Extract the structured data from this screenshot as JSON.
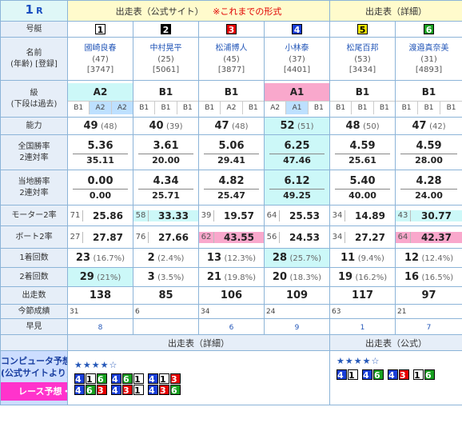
{
  "race": {
    "num": "1",
    "unit": "R"
  },
  "header": {
    "official": "出走表（公式サイト）",
    "former": "※これまでの形式",
    "detail": "出走表（詳細）"
  },
  "labels": {
    "frame": "号艇",
    "name": "名前",
    "name_sub": "(年齢) [登録]",
    "grade": "級",
    "grade_sub": "(下段は過去)",
    "ability": "能力",
    "nat": "全国勝率",
    "nat2": "2連対率",
    "loc": "当地勝率",
    "loc2": "2連対率",
    "motor": "モーター2率",
    "boat": "ボート2率",
    "first": "1着回数",
    "second": "2着回数",
    "starts": "出走数",
    "series": "今節成績",
    "tips": "早見"
  },
  "racers": [
    {
      "frame": "1",
      "name": "國崎良春",
      "age": "(47)",
      "reg": "[3747]",
      "grade": "A2",
      "past": [
        "B1",
        "A2",
        "A2"
      ],
      "ability": "49",
      "ability_prev": "(48)",
      "nat_win": "5.36",
      "nat_2": "35.11",
      "loc_win": "0.00",
      "loc_2": "0.00",
      "motor_no": "71",
      "motor_rate": "25.86",
      "boat_no": "27",
      "boat_rate": "27.87",
      "first": "23",
      "first_pct": "(16.7%)",
      "second": "29",
      "second_pct": "(21%)",
      "starts": "138",
      "series": "31",
      "tip": "8"
    },
    {
      "frame": "2",
      "name": "中村晃平",
      "age": "(25)",
      "reg": "[5061]",
      "grade": "B1",
      "past": [
        "B1",
        "B1",
        "B1"
      ],
      "ability": "40",
      "ability_prev": "(39)",
      "nat_win": "3.61",
      "nat_2": "20.00",
      "loc_win": "4.34",
      "loc_2": "25.71",
      "motor_no": "58",
      "motor_rate": "33.33",
      "boat_no": "76",
      "boat_rate": "27.66",
      "first": "2",
      "first_pct": "(2.4%)",
      "second": "3",
      "second_pct": "(3.5%)",
      "starts": "85",
      "series": "6",
      "tip": ""
    },
    {
      "frame": "3",
      "name": "松浦博人",
      "age": "(45)",
      "reg": "[3877]",
      "grade": "B1",
      "past": [
        "B1",
        "A2",
        "B1"
      ],
      "ability": "47",
      "ability_prev": "(48)",
      "nat_win": "5.06",
      "nat_2": "29.41",
      "loc_win": "4.82",
      "loc_2": "25.47",
      "motor_no": "39",
      "motor_rate": "19.57",
      "boat_no": "62",
      "boat_rate": "43.55",
      "first": "13",
      "first_pct": "(12.3%)",
      "second": "21",
      "second_pct": "(19.8%)",
      "starts": "106",
      "series": "34",
      "tip": "6"
    },
    {
      "frame": "4",
      "name": "小林泰",
      "age": "(37)",
      "reg": "[4401]",
      "grade": "A1",
      "past": [
        "A2",
        "A1",
        "B1"
      ],
      "ability": "52",
      "ability_prev": "(51)",
      "nat_win": "6.25",
      "nat_2": "47.46",
      "loc_win": "6.12",
      "loc_2": "49.25",
      "motor_no": "64",
      "motor_rate": "25.53",
      "boat_no": "56",
      "boat_rate": "24.53",
      "first": "28",
      "first_pct": "(25.7%)",
      "second": "20",
      "second_pct": "(18.3%)",
      "starts": "109",
      "series": "24",
      "tip": "9"
    },
    {
      "frame": "5",
      "name": "松尾百邦",
      "age": "(53)",
      "reg": "[3434]",
      "grade": "B1",
      "past": [
        "B1",
        "B1",
        "B1"
      ],
      "ability": "48",
      "ability_prev": "(50)",
      "nat_win": "4.59",
      "nat_2": "25.61",
      "loc_win": "5.40",
      "loc_2": "40.00",
      "motor_no": "34",
      "motor_rate": "14.89",
      "boat_no": "34",
      "boat_rate": "27.27",
      "first": "11",
      "first_pct": "(9.4%)",
      "second": "19",
      "second_pct": "(16.2%)",
      "starts": "117",
      "series": "63",
      "tip": "1"
    },
    {
      "frame": "6",
      "name": "渡邉真奈美",
      "age": "(31)",
      "reg": "[4893]",
      "grade": "B1",
      "past": [
        "B1",
        "B1",
        "B1"
      ],
      "ability": "47",
      "ability_prev": "(42)",
      "nat_win": "4.59",
      "nat_2": "28.00",
      "loc_win": "4.28",
      "loc_2": "24.00",
      "motor_no": "43",
      "motor_rate": "30.77",
      "boat_no": "64",
      "boat_rate": "42.37",
      "first": "12",
      "first_pct": "(12.4%)",
      "second": "16",
      "second_pct": "(16.5%)",
      "starts": "97",
      "series": "21",
      "tip": "7"
    }
  ],
  "footer": {
    "detail": "出走表（詳細）",
    "official": "出走表（公式）",
    "computer_title": "コンピュータ予想",
    "computer_sub": "(公式サイトより)",
    "result_btn": "レース予想・結果",
    "stars_left": "★★★★☆",
    "stars_right": "★★★★☆",
    "combos_left": [
      [
        "4",
        "1",
        "6"
      ],
      [
        "4",
        "6",
        "1"
      ],
      [
        "4",
        "1",
        "3"
      ],
      [
        "4",
        "6",
        "3"
      ],
      [
        "4",
        "3",
        "1"
      ],
      [
        "4",
        "3",
        "6"
      ]
    ],
    "combos_right": [
      [
        "4",
        "1"
      ],
      [
        "4",
        "6"
      ],
      [
        "4",
        "3"
      ],
      [
        "1",
        "6"
      ]
    ]
  }
}
